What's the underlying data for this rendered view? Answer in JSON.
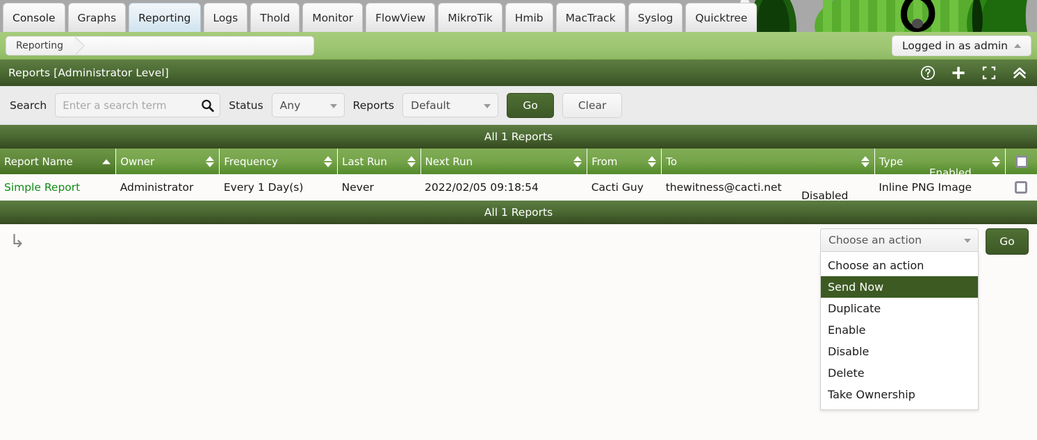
{
  "tabs": [
    {
      "label": "Console",
      "active": false
    },
    {
      "label": "Graphs",
      "active": false
    },
    {
      "label": "Reporting",
      "active": true
    },
    {
      "label": "Logs",
      "active": false
    },
    {
      "label": "Thold",
      "active": false
    },
    {
      "label": "Monitor",
      "active": false
    },
    {
      "label": "FlowView",
      "active": false
    },
    {
      "label": "MikroTik",
      "active": false
    },
    {
      "label": "Hmib",
      "active": false
    },
    {
      "label": "MacTrack",
      "active": false
    },
    {
      "label": "Syslog",
      "active": false
    },
    {
      "label": "Quicktree",
      "active": false
    }
  ],
  "breadcrumb": {
    "items": [
      "Reporting"
    ]
  },
  "user": {
    "label": "Logged in as admin",
    "caret_icon": "triangle-up-icon"
  },
  "panel": {
    "title": "Reports [Administrator Level]",
    "icons": [
      {
        "name": "help-icon",
        "glyph": "?"
      },
      {
        "name": "add-icon",
        "glyph": "+"
      },
      {
        "name": "fullscreen-icon",
        "glyph": "[ ]"
      },
      {
        "name": "collapse-icon",
        "glyph": "chevron-double-up"
      }
    ]
  },
  "filter": {
    "search_label": "Search",
    "search_placeholder": "Enter a search term",
    "search_value": "",
    "search_icon": "magnifier-icon",
    "status_label": "Status",
    "status_value": "Any",
    "reports_label": "Reports",
    "reports_value": "Default",
    "go_label": "Go",
    "clear_label": "Clear"
  },
  "table": {
    "count_top": "All 1 Reports",
    "count_bottom": "All 1 Reports",
    "columns": [
      {
        "label": "Report Name",
        "sorted": true,
        "sort_dir": "asc"
      },
      {
        "label": "Owner",
        "sorted": false,
        "sort_dir": "both"
      },
      {
        "label": "Frequency",
        "sorted": false,
        "sort_dir": "both"
      },
      {
        "label": "Last Run",
        "sorted": false,
        "sort_dir": "both"
      },
      {
        "label": "Next Run",
        "sorted": false,
        "sort_dir": "both"
      },
      {
        "label": "From",
        "sorted": false,
        "sort_dir": "both"
      },
      {
        "label": "To",
        "sorted": false,
        "sort_dir": "both"
      },
      {
        "label": "Type",
        "sorted": false,
        "sort_dir": "both"
      },
      {
        "label": "Enabled",
        "sorted": false,
        "sort_dir": "both"
      }
    ],
    "select_all_checked": false,
    "rows": [
      {
        "name": "Simple Report",
        "owner": "Administrator",
        "frequency": "Every 1 Day(s)",
        "last_run": "Never",
        "next_run": "2022/02/05 09:18:54",
        "from": "Cacti Guy",
        "to": "thewitness@cacti.net",
        "type": "Inline PNG Image",
        "enabled": "Disabled",
        "checked": false
      }
    ]
  },
  "actions": {
    "return_arrow_icon": "↳",
    "dropdown_value": "Choose an action",
    "dropdown_caret_icon": "chevron-down-icon",
    "options": [
      {
        "label": "Choose an action",
        "selected": false
      },
      {
        "label": "Send Now",
        "selected": true
      },
      {
        "label": "Duplicate",
        "selected": false
      },
      {
        "label": "Enable",
        "selected": false
      },
      {
        "label": "Disable",
        "selected": false
      },
      {
        "label": "Delete",
        "selected": false
      },
      {
        "label": "Take Ownership",
        "selected": false
      }
    ],
    "go_label": "Go"
  },
  "colors": {
    "brand_green": "#6aa141",
    "panel_dark": "#3d5a23",
    "link_green": "#0f8b16",
    "crumb_green": "#9cc571",
    "tab_active": "#cfe3ef"
  }
}
